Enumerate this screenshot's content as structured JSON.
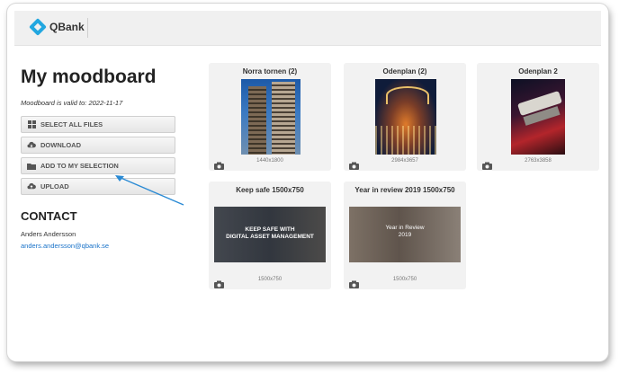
{
  "app": {
    "logo_text": "QBank"
  },
  "moodboard": {
    "title": "My moodboard",
    "valid_text": "Moodboard is valid to: 2022-11-17"
  },
  "actions": {
    "select_all": "SELECT ALL FILES",
    "download": "DOWNLOAD",
    "add_selection": "ADD TO MY SELECTION",
    "upload": "UPLOAD"
  },
  "contact": {
    "heading": "CONTACT",
    "name": "Anders Andersson",
    "email": "anders.andersson@qbank.se"
  },
  "cards": [
    {
      "title": "Norra tornen (2)",
      "dims": "1440x1800"
    },
    {
      "title": "Odenplan (2)",
      "dims": "2984x3657"
    },
    {
      "title": "Odenplan 2",
      "dims": "2763x3858"
    },
    {
      "title": "Keep safe 1500x750",
      "dims": "1500x750",
      "overlay": "KEEP SAFE WITH\nDIGITAL ASSET MANAGEMENT"
    },
    {
      "title": "Year in review 2019 1500x750",
      "dims": "1500x750",
      "overlay": "Year in Review\n2019"
    }
  ],
  "colors": {
    "accent": "#22a7e0",
    "link": "#1a73c9",
    "arrow": "#2a8ad4"
  }
}
